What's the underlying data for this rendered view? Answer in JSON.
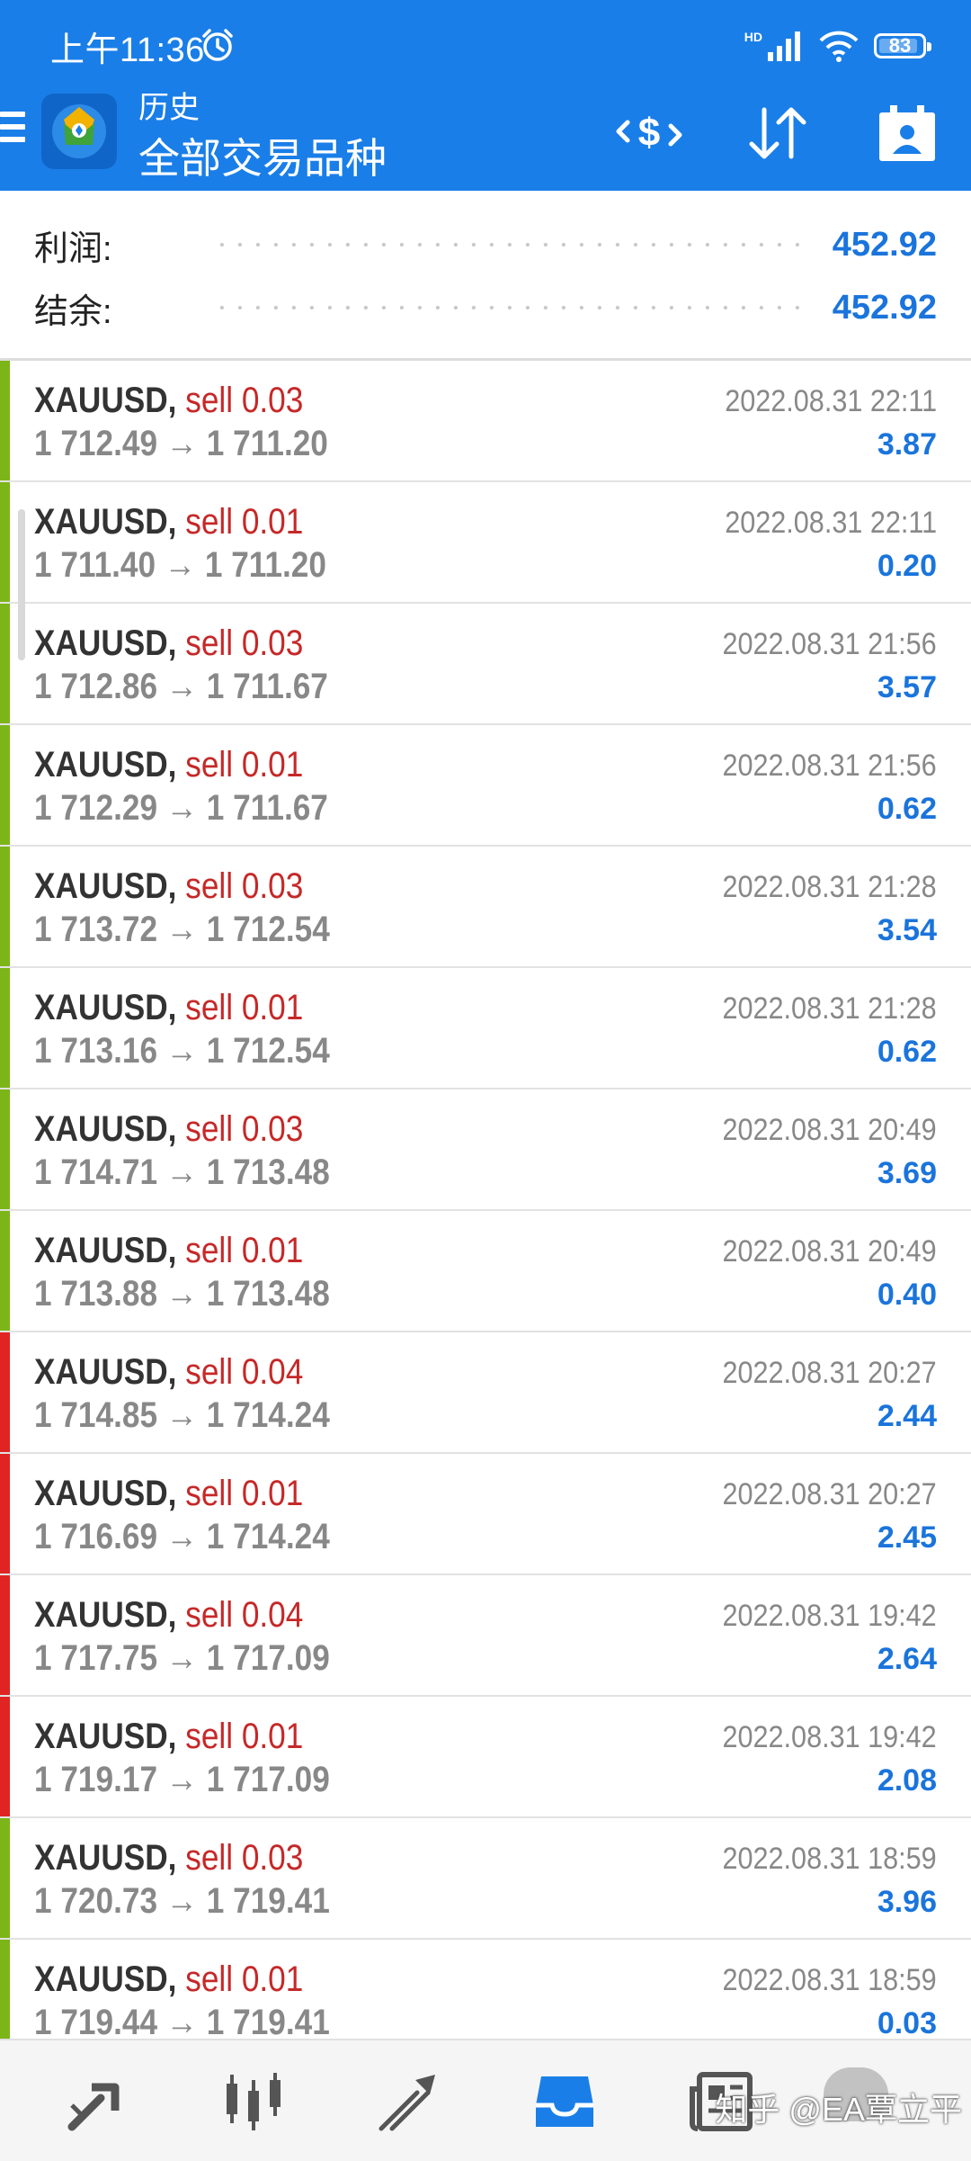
{
  "status_bar": {
    "time": "上午11:36",
    "network": "HD",
    "battery": "83"
  },
  "header": {
    "subtitle": "历史",
    "title": "全部交易品种"
  },
  "summary": {
    "profit_label": "利润:",
    "profit_value": "452.92",
    "balance_label": "结余:",
    "balance_value": "452.92"
  },
  "colors": {
    "header_bg": "#1a7ee8",
    "value_blue": "#1a74dc",
    "sell_red": "#c62828",
    "bar_green": "#7cb518",
    "bar_red": "#e02424"
  },
  "deals": [
    {
      "symbol": "XAUUSD,",
      "type": "sell 0.03",
      "open": "1 712.49",
      "close": "1 711.20",
      "time": "2022.08.31 22:11",
      "profit": "3.87",
      "bar": "green"
    },
    {
      "symbol": "XAUUSD,",
      "type": "sell 0.01",
      "open": "1 711.40",
      "close": "1 711.20",
      "time": "2022.08.31 22:11",
      "profit": "0.20",
      "bar": "green"
    },
    {
      "symbol": "XAUUSD,",
      "type": "sell 0.03",
      "open": "1 712.86",
      "close": "1 711.67",
      "time": "2022.08.31 21:56",
      "profit": "3.57",
      "bar": "green"
    },
    {
      "symbol": "XAUUSD,",
      "type": "sell 0.01",
      "open": "1 712.29",
      "close": "1 711.67",
      "time": "2022.08.31 21:56",
      "profit": "0.62",
      "bar": "green"
    },
    {
      "symbol": "XAUUSD,",
      "type": "sell 0.03",
      "open": "1 713.72",
      "close": "1 712.54",
      "time": "2022.08.31 21:28",
      "profit": "3.54",
      "bar": "green"
    },
    {
      "symbol": "XAUUSD,",
      "type": "sell 0.01",
      "open": "1 713.16",
      "close": "1 712.54",
      "time": "2022.08.31 21:28",
      "profit": "0.62",
      "bar": "green"
    },
    {
      "symbol": "XAUUSD,",
      "type": "sell 0.03",
      "open": "1 714.71",
      "close": "1 713.48",
      "time": "2022.08.31 20:49",
      "profit": "3.69",
      "bar": "green"
    },
    {
      "symbol": "XAUUSD,",
      "type": "sell 0.01",
      "open": "1 713.88",
      "close": "1 713.48",
      "time": "2022.08.31 20:49",
      "profit": "0.40",
      "bar": "green"
    },
    {
      "symbol": "XAUUSD,",
      "type": "sell 0.04",
      "open": "1 714.85",
      "close": "1 714.24",
      "time": "2022.08.31 20:27",
      "profit": "2.44",
      "bar": "red"
    },
    {
      "symbol": "XAUUSD,",
      "type": "sell 0.01",
      "open": "1 716.69",
      "close": "1 714.24",
      "time": "2022.08.31 20:27",
      "profit": "2.45",
      "bar": "red"
    },
    {
      "symbol": "XAUUSD,",
      "type": "sell 0.04",
      "open": "1 717.75",
      "close": "1 717.09",
      "time": "2022.08.31 19:42",
      "profit": "2.64",
      "bar": "red"
    },
    {
      "symbol": "XAUUSD,",
      "type": "sell 0.01",
      "open": "1 719.17",
      "close": "1 717.09",
      "time": "2022.08.31 19:42",
      "profit": "2.08",
      "bar": "red"
    },
    {
      "symbol": "XAUUSD,",
      "type": "sell 0.03",
      "open": "1 720.73",
      "close": "1 719.41",
      "time": "2022.08.31 18:59",
      "profit": "3.96",
      "bar": "green"
    },
    {
      "symbol": "XAUUSD,",
      "type": "sell 0.01",
      "open": "1 719.44",
      "close": "1 719.41",
      "time": "2022.08.31 18:59",
      "profit": "0.03",
      "bar": "green"
    }
  ],
  "bottom_nav": {
    "items": [
      {
        "icon": "quotes-icon"
      },
      {
        "icon": "chart-icon"
      },
      {
        "icon": "trade-icon"
      },
      {
        "icon": "history-icon",
        "active": true
      },
      {
        "icon": "news-icon"
      },
      {
        "icon": "chat-icon"
      }
    ],
    "watermark": "知乎 @EA覃立平"
  }
}
